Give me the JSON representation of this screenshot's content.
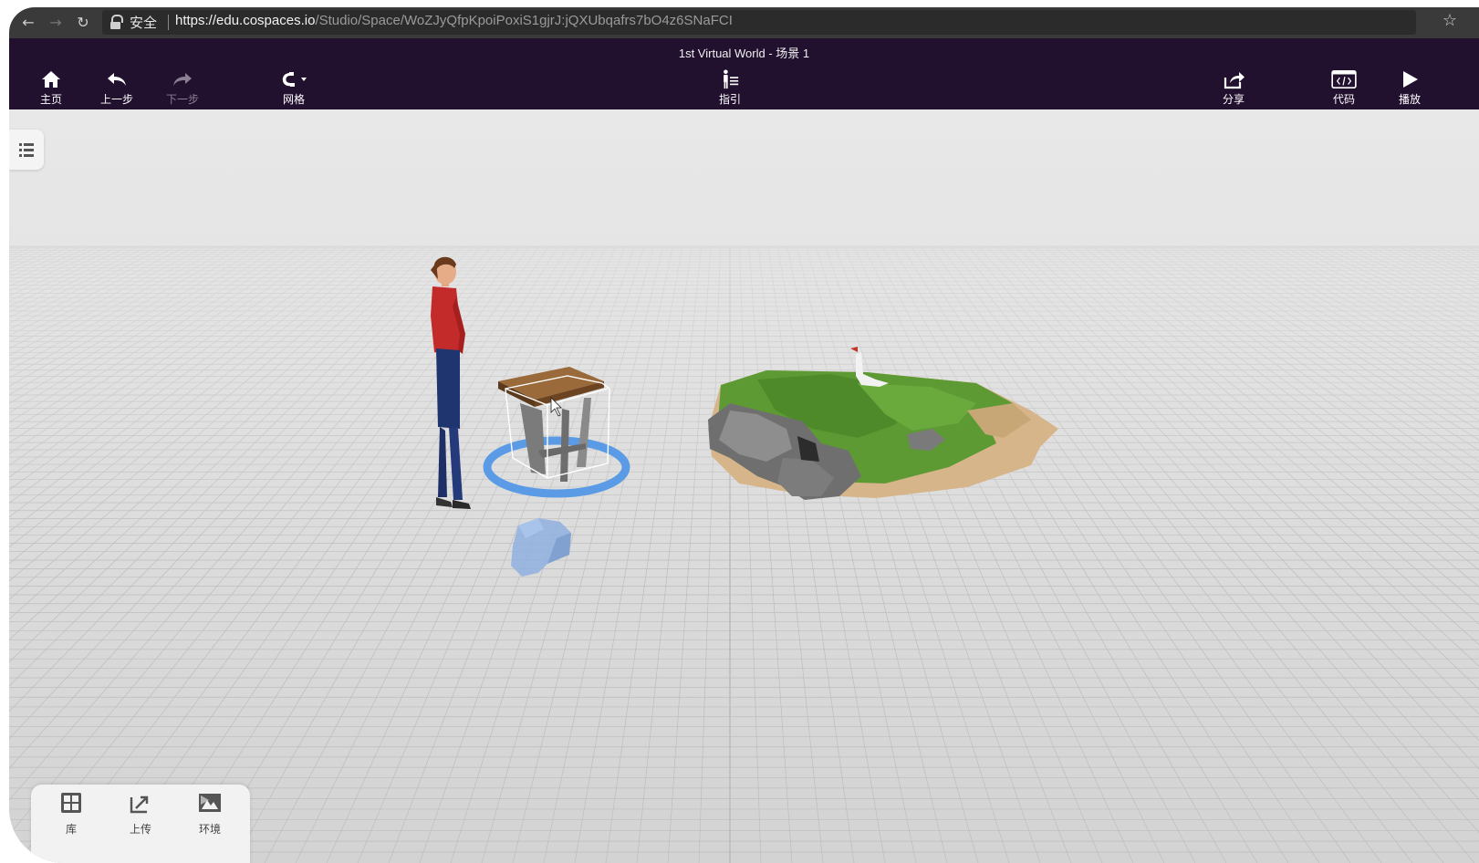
{
  "browser": {
    "secure_label": "安全",
    "url_host": "https://edu.cospaces.io",
    "url_path": "/Studio/Space/WoZJyQfpKpoiPoxiS1gjrJ:jQXUbqafrs7bO4z6SNaFCI"
  },
  "app": {
    "title": "1st Virtual World - 场景 1",
    "toolbar": {
      "home": "主页",
      "undo": "上一步",
      "redo": "下一步",
      "grid": "网格",
      "guide": "指引",
      "share": "分享",
      "code": "代码",
      "play": "播放"
    }
  },
  "bottom_panel": {
    "library": "库",
    "upload": "上传",
    "environment": "环境"
  },
  "colors": {
    "toolbar_bg": "#22102f",
    "selection_ring": "#5b9be6",
    "ground": "#dcdcdc"
  }
}
